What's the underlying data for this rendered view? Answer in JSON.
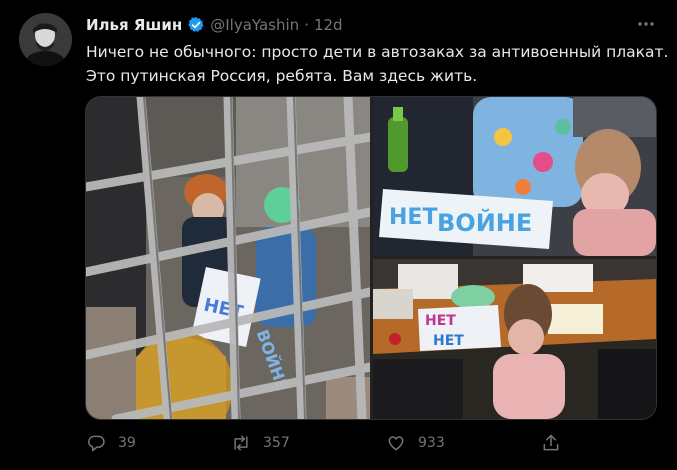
{
  "tweet": {
    "author_name": "Илья Яшин",
    "author_handle": "@IlyaYashin",
    "separator": "·",
    "timestamp": "12d",
    "text_line1": "Ничего не обычного: просто дети в автозаках за антивоенный плакат.",
    "text_line2": "Это путинская Россия, ребята. Вам здесь жить."
  },
  "media": {
    "photo1_sign": "НЕТ",
    "photo1_sign_b": "ВОЙНЕ",
    "photo2_sign_word1": "НЕТ",
    "photo2_sign_word2": "ВОЙНЕ",
    "photo3_sign_word1": "НЕТ",
    "photo3_sign_word2": "НЕТ"
  },
  "actions": {
    "reply_count": "39",
    "retweet_count": "357",
    "like_count": "933"
  },
  "icons": {
    "verified": "verified-badge-icon",
    "more": "more-horizontal-icon",
    "reply": "reply-icon",
    "retweet": "retweet-icon",
    "like": "heart-icon",
    "share": "share-icon"
  },
  "colors": {
    "background": "#000000",
    "text_primary": "#e7e9ea",
    "text_secondary": "#71767b",
    "verified": "#1d9bf0"
  }
}
